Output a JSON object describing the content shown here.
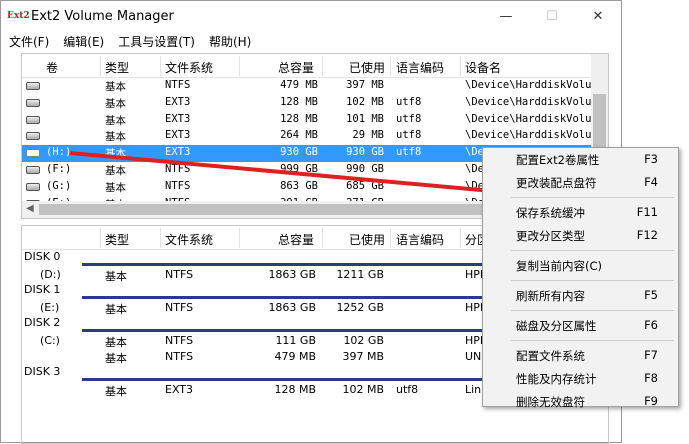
{
  "window": {
    "title": "Ext2 Volume Manager",
    "icon_text": "Ext2"
  },
  "menu": [
    "文件(F)",
    "编辑(E)",
    "工具与设置(T)",
    "帮助(H)"
  ],
  "top_headers": [
    "卷",
    "类型",
    "文件系统",
    "总容量",
    "已使用",
    "语言编码",
    "设备名"
  ],
  "top_rows": [
    {
      "vol": "",
      "type": "基本",
      "fs": "NTFS",
      "total": "479 MB",
      "used": "397 MB",
      "enc": "",
      "dev": "\\Device\\HarddiskVolum"
    },
    {
      "vol": "",
      "type": "基本",
      "fs": "EXT3",
      "total": "128 MB",
      "used": "102 MB",
      "enc": "utf8",
      "dev": "\\Device\\HarddiskVolum"
    },
    {
      "vol": "",
      "type": "基本",
      "fs": "EXT3",
      "total": "128 MB",
      "used": "101 MB",
      "enc": "utf8",
      "dev": "\\Device\\HarddiskVolum"
    },
    {
      "vol": "",
      "type": "基本",
      "fs": "EXT3",
      "total": "264 MB",
      "used": "29 MB",
      "enc": "utf8",
      "dev": "\\Device\\HarddiskVolum"
    },
    {
      "vol": "(H:)",
      "type": "基本",
      "fs": "EXT3",
      "total": "930 GB",
      "used": "930 GB",
      "enc": "utf8",
      "dev": "\\De",
      "selected": true
    },
    {
      "vol": "(F:)",
      "type": "基本",
      "fs": "NTFS",
      "total": "999 GB",
      "used": "990 GB",
      "enc": "",
      "dev": "\\De"
    },
    {
      "vol": "(G:)",
      "type": "基本",
      "fs": "NTFS",
      "total": "863 GB",
      "used": "685 GB",
      "enc": "",
      "dev": "\\De"
    },
    {
      "vol": "(E:)",
      "type": "基本",
      "fs": "NTFS",
      "total": "391 GB",
      "used": "271 GB",
      "enc": "",
      "dev": "\\De"
    }
  ],
  "bottom_headers": [
    "类型",
    "文件系统",
    "总容量",
    "已使用",
    "语言编码",
    "分区"
  ],
  "disks": [
    {
      "label": "DISK 0",
      "rows": [
        {
          "vol": "(D:)",
          "type": "基本",
          "fs": "NTFS",
          "total": "1863 GB",
          "used": "1211 GB",
          "enc": "",
          "part": "HPF"
        }
      ]
    },
    {
      "label": "DISK 1",
      "rows": [
        {
          "vol": "(E:)",
          "type": "基本",
          "fs": "NTFS",
          "total": "1863 GB",
          "used": "1252 GB",
          "enc": "",
          "part": "HPF"
        }
      ]
    },
    {
      "label": "DISK 2",
      "rows": [
        {
          "vol": "(C:)",
          "type": "基本",
          "fs": "NTFS",
          "total": "111 GB",
          "used": "102 GB",
          "enc": "",
          "part": "HPF"
        },
        {
          "vol": "",
          "type": "基本",
          "fs": "NTFS",
          "total": "479 MB",
          "used": "397 MB",
          "enc": "",
          "part": "UNI"
        }
      ]
    },
    {
      "label": "DISK 3",
      "rows": [
        {
          "vol": "",
          "type": "基本",
          "fs": "EXT3",
          "total": "128 MB",
          "used": "102 MB",
          "enc": "utf8",
          "part": "Linux"
        }
      ]
    }
  ],
  "context_menu": [
    {
      "label": "配置Ext2卷属性",
      "key": "F3"
    },
    {
      "label": "更改装配点盘符",
      "key": "F4"
    },
    {
      "sep": true
    },
    {
      "label": "保存系统缓冲",
      "key": "F11"
    },
    {
      "label": "更改分区类型",
      "key": "F12"
    },
    {
      "sep": true
    },
    {
      "label": "复制当前内容(C)",
      "key": ""
    },
    {
      "sep": true
    },
    {
      "label": "刷新所有内容",
      "key": "F5"
    },
    {
      "sep": true
    },
    {
      "label": "磁盘及分区属性",
      "key": "F6"
    },
    {
      "sep": true
    },
    {
      "label": "配置文件系统",
      "key": "F7"
    },
    {
      "label": "性能及内存统计",
      "key": "F8"
    },
    {
      "label": "删除无效盘符",
      "key": "F9"
    }
  ],
  "colors": {
    "selection": "#3399ff",
    "arrow": "#e02020",
    "disk_bar": "#2b3a8a"
  }
}
